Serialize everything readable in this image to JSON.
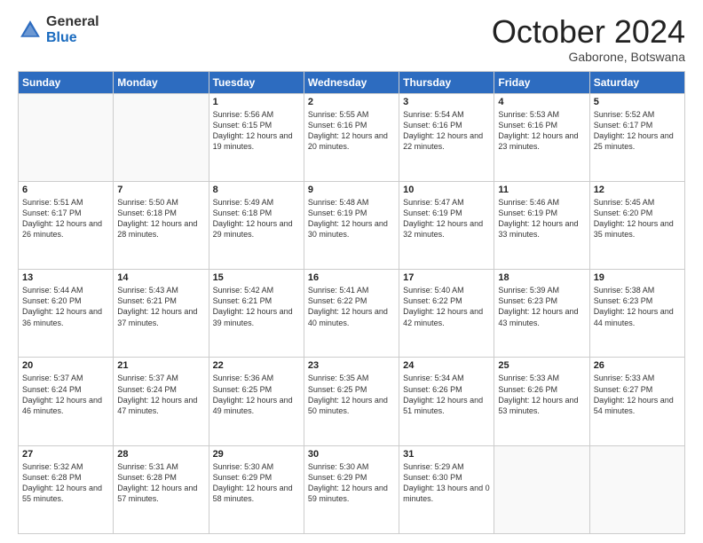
{
  "header": {
    "logo_general": "General",
    "logo_blue": "Blue",
    "month_title": "October 2024",
    "location": "Gaborone, Botswana"
  },
  "calendar": {
    "days_of_week": [
      "Sunday",
      "Monday",
      "Tuesday",
      "Wednesday",
      "Thursday",
      "Friday",
      "Saturday"
    ],
    "weeks": [
      [
        {
          "day": "",
          "info": ""
        },
        {
          "day": "",
          "info": ""
        },
        {
          "day": "1",
          "info": "Sunrise: 5:56 AM\nSunset: 6:15 PM\nDaylight: 12 hours and 19 minutes."
        },
        {
          "day": "2",
          "info": "Sunrise: 5:55 AM\nSunset: 6:16 PM\nDaylight: 12 hours and 20 minutes."
        },
        {
          "day": "3",
          "info": "Sunrise: 5:54 AM\nSunset: 6:16 PM\nDaylight: 12 hours and 22 minutes."
        },
        {
          "day": "4",
          "info": "Sunrise: 5:53 AM\nSunset: 6:16 PM\nDaylight: 12 hours and 23 minutes."
        },
        {
          "day": "5",
          "info": "Sunrise: 5:52 AM\nSunset: 6:17 PM\nDaylight: 12 hours and 25 minutes."
        }
      ],
      [
        {
          "day": "6",
          "info": "Sunrise: 5:51 AM\nSunset: 6:17 PM\nDaylight: 12 hours and 26 minutes."
        },
        {
          "day": "7",
          "info": "Sunrise: 5:50 AM\nSunset: 6:18 PM\nDaylight: 12 hours and 28 minutes."
        },
        {
          "day": "8",
          "info": "Sunrise: 5:49 AM\nSunset: 6:18 PM\nDaylight: 12 hours and 29 minutes."
        },
        {
          "day": "9",
          "info": "Sunrise: 5:48 AM\nSunset: 6:19 PM\nDaylight: 12 hours and 30 minutes."
        },
        {
          "day": "10",
          "info": "Sunrise: 5:47 AM\nSunset: 6:19 PM\nDaylight: 12 hours and 32 minutes."
        },
        {
          "day": "11",
          "info": "Sunrise: 5:46 AM\nSunset: 6:19 PM\nDaylight: 12 hours and 33 minutes."
        },
        {
          "day": "12",
          "info": "Sunrise: 5:45 AM\nSunset: 6:20 PM\nDaylight: 12 hours and 35 minutes."
        }
      ],
      [
        {
          "day": "13",
          "info": "Sunrise: 5:44 AM\nSunset: 6:20 PM\nDaylight: 12 hours and 36 minutes."
        },
        {
          "day": "14",
          "info": "Sunrise: 5:43 AM\nSunset: 6:21 PM\nDaylight: 12 hours and 37 minutes."
        },
        {
          "day": "15",
          "info": "Sunrise: 5:42 AM\nSunset: 6:21 PM\nDaylight: 12 hours and 39 minutes."
        },
        {
          "day": "16",
          "info": "Sunrise: 5:41 AM\nSunset: 6:22 PM\nDaylight: 12 hours and 40 minutes."
        },
        {
          "day": "17",
          "info": "Sunrise: 5:40 AM\nSunset: 6:22 PM\nDaylight: 12 hours and 42 minutes."
        },
        {
          "day": "18",
          "info": "Sunrise: 5:39 AM\nSunset: 6:23 PM\nDaylight: 12 hours and 43 minutes."
        },
        {
          "day": "19",
          "info": "Sunrise: 5:38 AM\nSunset: 6:23 PM\nDaylight: 12 hours and 44 minutes."
        }
      ],
      [
        {
          "day": "20",
          "info": "Sunrise: 5:37 AM\nSunset: 6:24 PM\nDaylight: 12 hours and 46 minutes."
        },
        {
          "day": "21",
          "info": "Sunrise: 5:37 AM\nSunset: 6:24 PM\nDaylight: 12 hours and 47 minutes."
        },
        {
          "day": "22",
          "info": "Sunrise: 5:36 AM\nSunset: 6:25 PM\nDaylight: 12 hours and 49 minutes."
        },
        {
          "day": "23",
          "info": "Sunrise: 5:35 AM\nSunset: 6:25 PM\nDaylight: 12 hours and 50 minutes."
        },
        {
          "day": "24",
          "info": "Sunrise: 5:34 AM\nSunset: 6:26 PM\nDaylight: 12 hours and 51 minutes."
        },
        {
          "day": "25",
          "info": "Sunrise: 5:33 AM\nSunset: 6:26 PM\nDaylight: 12 hours and 53 minutes."
        },
        {
          "day": "26",
          "info": "Sunrise: 5:33 AM\nSunset: 6:27 PM\nDaylight: 12 hours and 54 minutes."
        }
      ],
      [
        {
          "day": "27",
          "info": "Sunrise: 5:32 AM\nSunset: 6:28 PM\nDaylight: 12 hours and 55 minutes."
        },
        {
          "day": "28",
          "info": "Sunrise: 5:31 AM\nSunset: 6:28 PM\nDaylight: 12 hours and 57 minutes."
        },
        {
          "day": "29",
          "info": "Sunrise: 5:30 AM\nSunset: 6:29 PM\nDaylight: 12 hours and 58 minutes."
        },
        {
          "day": "30",
          "info": "Sunrise: 5:30 AM\nSunset: 6:29 PM\nDaylight: 12 hours and 59 minutes."
        },
        {
          "day": "31",
          "info": "Sunrise: 5:29 AM\nSunset: 6:30 PM\nDaylight: 13 hours and 0 minutes."
        },
        {
          "day": "",
          "info": ""
        },
        {
          "day": "",
          "info": ""
        }
      ]
    ]
  }
}
